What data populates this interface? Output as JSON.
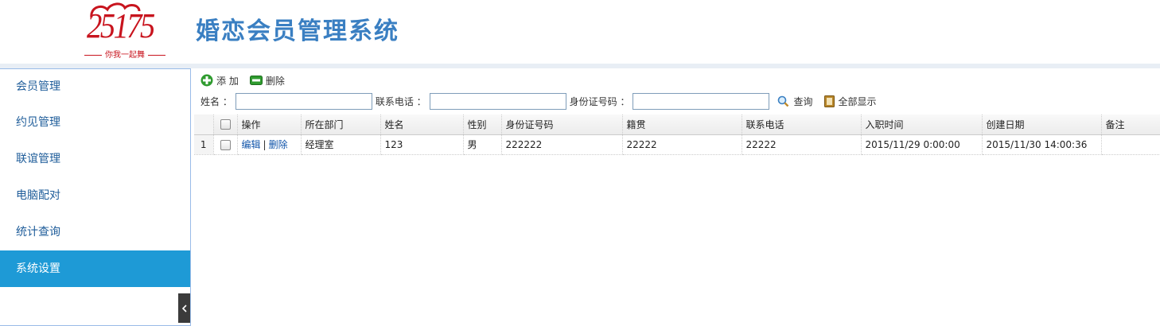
{
  "header": {
    "logo_number": "25175",
    "logo_slogan": "你我一起舞",
    "app_title": "婚恋会员管理系统"
  },
  "sidebar": {
    "items": [
      {
        "label": "会员管理",
        "active": false
      },
      {
        "label": "约见管理",
        "active": false
      },
      {
        "label": "联谊管理",
        "active": false
      },
      {
        "label": "电脑配对",
        "active": false
      },
      {
        "label": "统计查询",
        "active": false
      },
      {
        "label": "系统设置",
        "active": true
      }
    ],
    "active_color": "#1e9ad6",
    "collapse_icon": "chevron-left-icon"
  },
  "toolbar": {
    "add_label": "添 加",
    "delete_label": "删除"
  },
  "search": {
    "name_label": "姓名 ：",
    "name_value": "",
    "phone_label": "联系电话 ：",
    "phone_value": "",
    "id_label": "身份证号码 ：",
    "id_value": "",
    "query_label": "查询",
    "show_all_label": "全部显示"
  },
  "grid": {
    "columns": [
      "操作",
      "所在部门",
      "姓名",
      "性别",
      "身份证号码",
      "籍贯",
      "联系电话",
      "入职时间",
      "创建日期",
      "备注"
    ],
    "rows": [
      {
        "row_number": "1",
        "edit_label": "编辑",
        "separator": "|",
        "delete_label": "删除",
        "department": "经理室",
        "name": "123",
        "gender": "男",
        "id_number": "222222",
        "native_place": "22222",
        "phone": "22222",
        "hire_time": "2015/11/29 0:00:00",
        "created_date": "2015/11/30 14:00:36",
        "remark": ""
      }
    ]
  }
}
